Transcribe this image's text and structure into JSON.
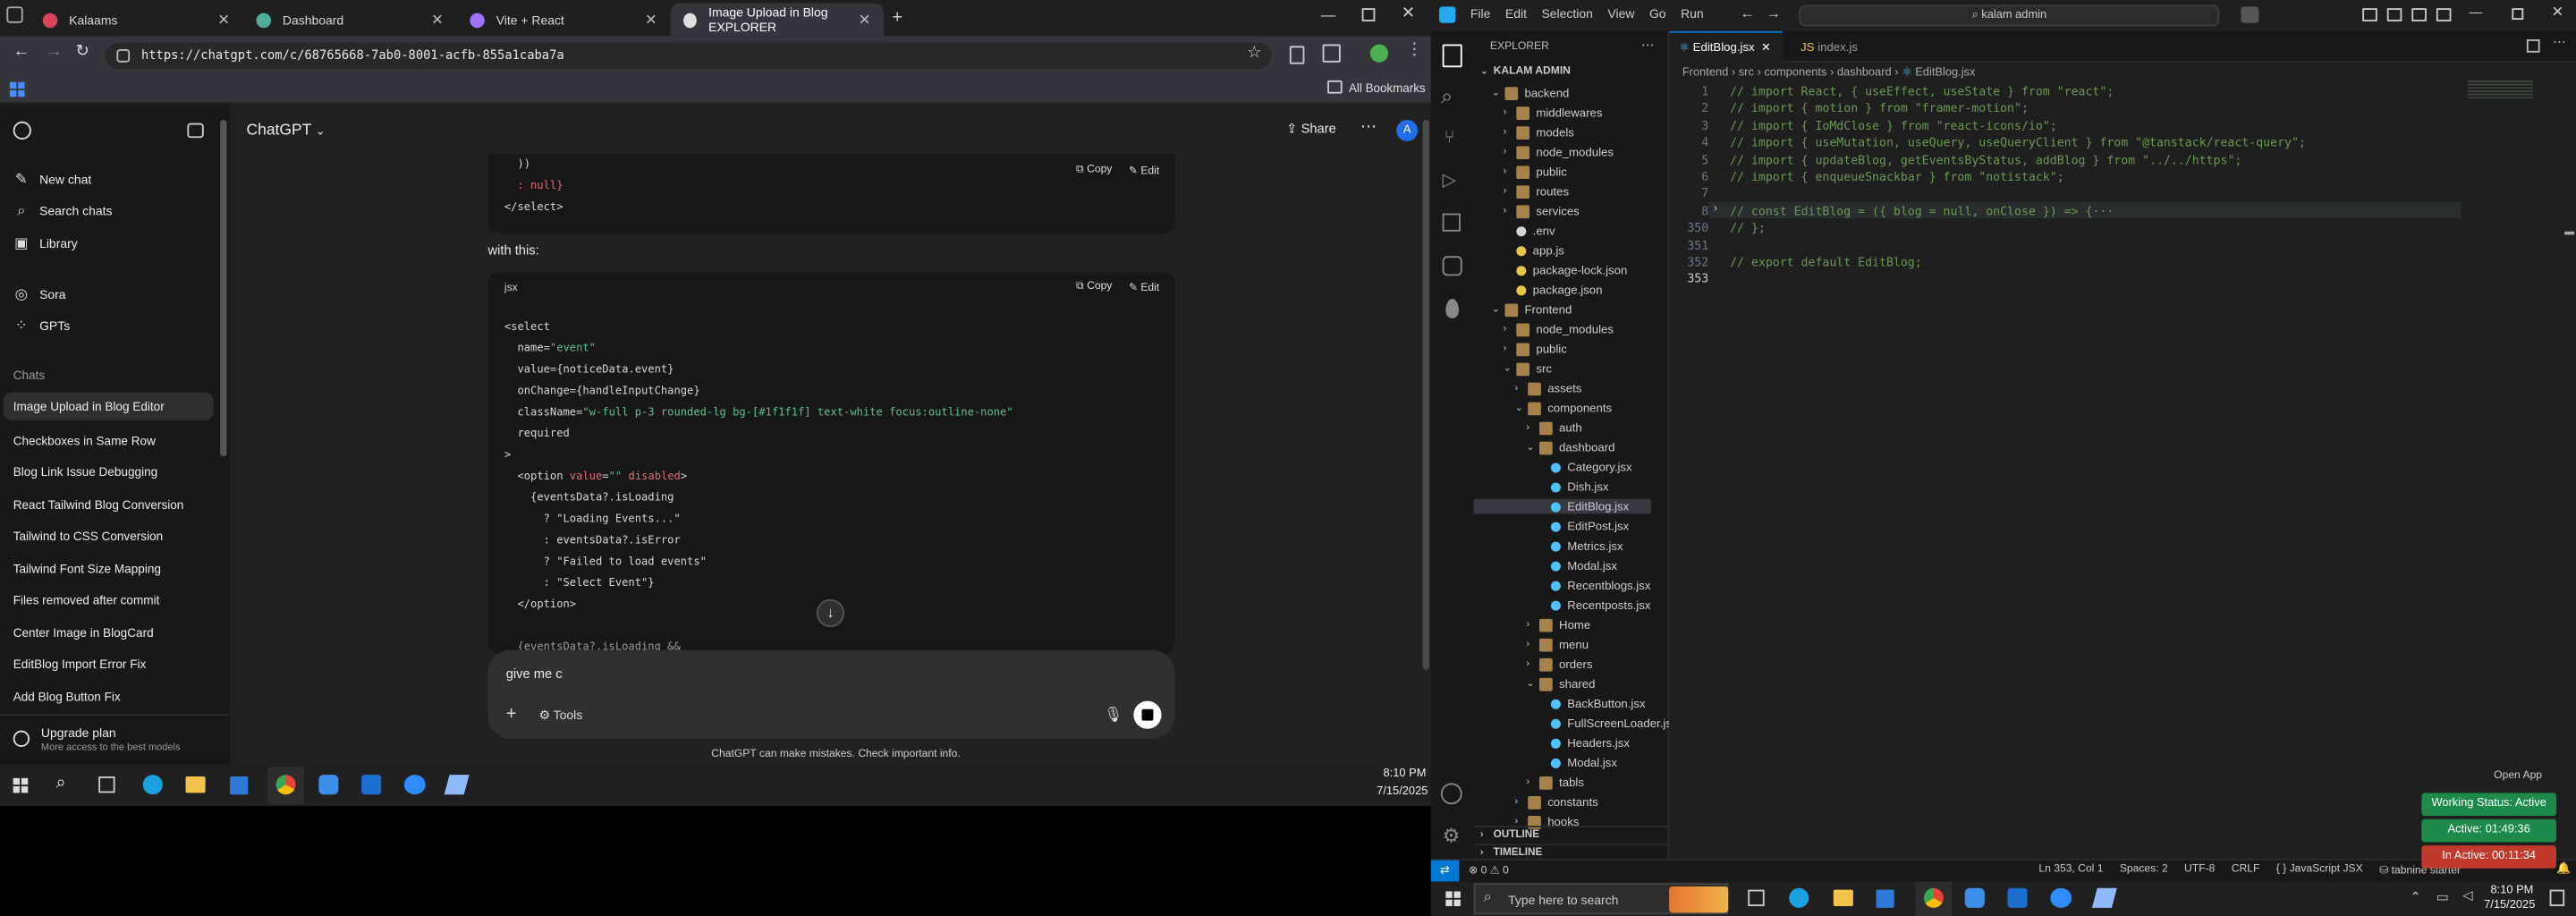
{
  "browser": {
    "tabs": [
      {
        "label": "Kalaams",
        "color": "#d6455a"
      },
      {
        "label": "Dashboard",
        "color": "#4caf9a"
      },
      {
        "label": "Vite + React",
        "color": "#a070ff"
      },
      {
        "label": "Image Upload in Blog EXPLORER",
        "color": "#e0e0e0"
      }
    ],
    "url": "https://chatgpt.com/c/68765668-7ab0-8001-acfb-855a1caba7a",
    "bookmarks_label": "All Bookmarks"
  },
  "chatgpt": {
    "header_title": "ChatGPT",
    "share_label": "Share",
    "avatar_letter": "A",
    "nav": [
      {
        "label": "New chat",
        "icon": "new-chat-icon"
      },
      {
        "label": "Search chats",
        "icon": "search-icon"
      },
      {
        "label": "Library",
        "icon": "library-icon"
      },
      {
        "label": "Sora",
        "icon": "sora-icon"
      },
      {
        "label": "GPTs",
        "icon": "gpts-icon"
      }
    ],
    "chats_heading": "Chats",
    "chats": [
      "Image Upload in Blog Editor",
      "Checkboxes in Same Row",
      "Blog Link Issue Debugging",
      "React Tailwind Blog Conversion",
      "Tailwind to CSS Conversion",
      "Tailwind Font Size Mapping",
      "Files removed after commit",
      "Center Image in BlogCard",
      "EditBlog Import Error Fix",
      "Add Blog Button Fix"
    ],
    "upgrade": {
      "title": "Upgrade plan",
      "subtitle": "More access to the best models"
    },
    "top_code": [
      "  ))",
      "  : null}",
      "</select>"
    ],
    "copy_label": "Copy",
    "edit_label": "Edit",
    "with_this": "with this:",
    "code_lang": "jsx",
    "composer_text": "give me c",
    "tools_label": "Tools",
    "disclaimer": "ChatGPT can make mistakes. Check important info."
  },
  "taskbar_left": {
    "time": "8:10 PM",
    "date": "7/15/2025"
  },
  "vscode": {
    "menu": [
      "File",
      "Edit",
      "Selection",
      "View",
      "Go",
      "Run"
    ],
    "search": "kalam admin",
    "explorer_title": "EXPLORER",
    "root": "KALAM ADMIN",
    "tabs": [
      "EditBlog.jsx",
      "index.js"
    ],
    "breadcrumb": [
      "Frontend",
      "src",
      "components",
      "dashboard",
      "EditBlog.jsx"
    ],
    "tree": [
      {
        "label": "backend",
        "depth": 1,
        "kind": "folder-open"
      },
      {
        "label": "middlewares",
        "depth": 2,
        "kind": "folder"
      },
      {
        "label": "models",
        "depth": 2,
        "kind": "folder"
      },
      {
        "label": "node_modules",
        "depth": 2,
        "kind": "folder"
      },
      {
        "label": "public",
        "depth": 2,
        "kind": "folder"
      },
      {
        "label": "routes",
        "depth": 2,
        "kind": "folder"
      },
      {
        "label": "services",
        "depth": 2,
        "kind": "folder"
      },
      {
        "label": ".env",
        "depth": 2,
        "kind": "file"
      },
      {
        "label": "app.js",
        "depth": 2,
        "kind": "js"
      },
      {
        "label": "package-lock.json",
        "depth": 2,
        "kind": "json"
      },
      {
        "label": "package.json",
        "depth": 2,
        "kind": "json"
      },
      {
        "label": "Frontend",
        "depth": 1,
        "kind": "folder-open"
      },
      {
        "label": "node_modules",
        "depth": 2,
        "kind": "folder"
      },
      {
        "label": "public",
        "depth": 2,
        "kind": "folder"
      },
      {
        "label": "src",
        "depth": 2,
        "kind": "folder-open"
      },
      {
        "label": "assets",
        "depth": 3,
        "kind": "folder"
      },
      {
        "label": "components",
        "depth": 3,
        "kind": "folder-open"
      },
      {
        "label": "auth",
        "depth": 4,
        "kind": "folder"
      },
      {
        "label": "dashboard",
        "depth": 4,
        "kind": "folder-open"
      },
      {
        "label": "Category.jsx",
        "depth": 5,
        "kind": "jsx"
      },
      {
        "label": "Dish.jsx",
        "depth": 5,
        "kind": "jsx"
      },
      {
        "label": "EditBlog.jsx",
        "depth": 5,
        "kind": "jsx"
      },
      {
        "label": "EditPost.jsx",
        "depth": 5,
        "kind": "jsx"
      },
      {
        "label": "Metrics.jsx",
        "depth": 5,
        "kind": "jsx"
      },
      {
        "label": "Modal.jsx",
        "depth": 5,
        "kind": "jsx"
      },
      {
        "label": "Recentblogs.jsx",
        "depth": 5,
        "kind": "jsx"
      },
      {
        "label": "Recentposts.jsx",
        "depth": 5,
        "kind": "jsx"
      },
      {
        "label": "Home",
        "depth": 4,
        "kind": "folder"
      },
      {
        "label": "menu",
        "depth": 4,
        "kind": "folder"
      },
      {
        "label": "orders",
        "depth": 4,
        "kind": "folder"
      },
      {
        "label": "shared",
        "depth": 4,
        "kind": "folder-open"
      },
      {
        "label": "BackButton.jsx",
        "depth": 5,
        "kind": "jsx"
      },
      {
        "label": "FullScreenLoader.jsx",
        "depth": 5,
        "kind": "jsx"
      },
      {
        "label": "Headers.jsx",
        "depth": 5,
        "kind": "jsx"
      },
      {
        "label": "Modal.jsx",
        "depth": 5,
        "kind": "jsx"
      },
      {
        "label": "tabls",
        "depth": 4,
        "kind": "folder"
      },
      {
        "label": "constants",
        "depth": 3,
        "kind": "folder"
      },
      {
        "label": "hooks",
        "depth": 3,
        "kind": "folder"
      }
    ],
    "outline": "OUTLINE",
    "timeline": "TIMELINE",
    "code_lines": [
      {
        "n": "1",
        "t": "// import React, { useEffect, useState } from \"react\";"
      },
      {
        "n": "2",
        "t": "// import { motion } from \"framer-motion\";"
      },
      {
        "n": "3",
        "t": "// import { IoMdClose } from \"react-icons/io\";"
      },
      {
        "n": "4",
        "t": "// import { useMutation, useQuery, useQueryClient } from \"@tanstack/react-query\";"
      },
      {
        "n": "5",
        "t": "// import { updateBlog, getEventsByStatus, addBlog } from \"../../https\";"
      },
      {
        "n": "6",
        "t": "// import { enqueueSnackbar } from \"notistack\";"
      },
      {
        "n": "7",
        "t": ""
      },
      {
        "n": "8",
        "t": "// const EditBlog = ({ blog = null, onClose }) => {···"
      },
      {
        "n": "350",
        "t": "// };"
      },
      {
        "n": "351",
        "t": ""
      },
      {
        "n": "352",
        "t": "// export default EditBlog;"
      },
      {
        "n": "353",
        "t": ""
      }
    ],
    "status": {
      "errors": "0",
      "warnings": "0",
      "position": "Ln 353, Col 1",
      "spaces": "Spaces: 2",
      "encoding": "UTF-8",
      "eol": "CRLF",
      "language": "JavaScript JSX",
      "tabnine": "tabnine starter"
    },
    "open_app": "Open App",
    "working_status": "Working Status: Active",
    "active_time": "Active: 01:49:36",
    "inactive_time": "In Active: 00:11:34"
  },
  "taskbar_right": {
    "search_placeholder": "Type here to search",
    "time": "8:10 PM",
    "date": "7/15/2025"
  }
}
